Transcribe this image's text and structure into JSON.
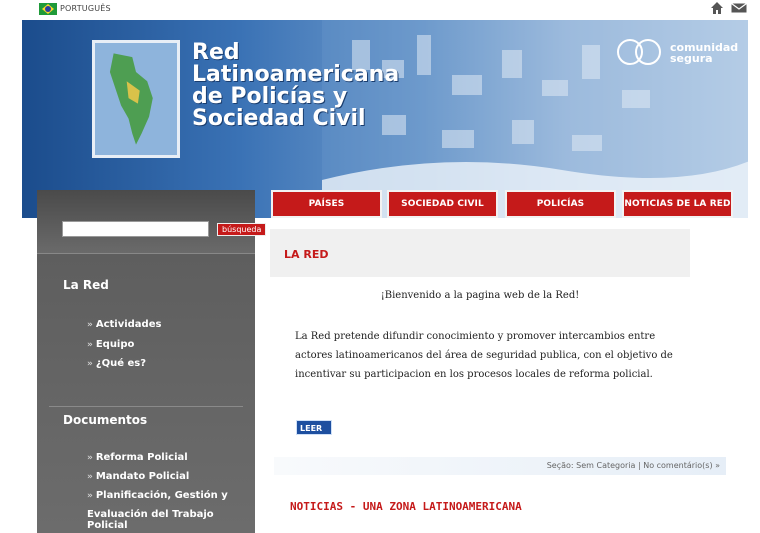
{
  "topbar": {
    "language": "PORTUGUÊS",
    "flag_icon": "brazil-flag-icon",
    "home_icon": "home-icon",
    "mail_icon": "mail-icon"
  },
  "banner": {
    "title_lines": [
      "Red",
      "Latinoamericana",
      "de Policías y",
      "Sociedad Civil"
    ],
    "partner_lines": [
      "comunidad",
      "segura"
    ]
  },
  "nav": {
    "items": [
      "PAÍSES",
      "SOCIEDAD CIVIL",
      "POLICÍAS",
      "NOTICIAS DE LA RED"
    ]
  },
  "sidebar": {
    "search": {
      "placeholder": "",
      "button_label": "búsqueda"
    },
    "sections": [
      {
        "heading": "La Red",
        "items": [
          "Actividades",
          "Equipo",
          "¿Qué es?"
        ]
      },
      {
        "heading": "Documentos",
        "items": [
          "Reforma Policial",
          "Mandato Policial",
          "Planificación, Gestión y",
          "Evaluación del Trabajo Policial"
        ]
      }
    ]
  },
  "main": {
    "section_title": "LA RED",
    "welcome": "¡Bienvenido a la pagina web de la Red!",
    "intro_lines": [
      "La Red pretende difundir conocimiento y promover intercambios entre",
      "actores latinoamericanos del área de seguridad publica, con el objetivo de",
      "incentivar su participacion en los procesos locales de reforma policial."
    ],
    "read_more": "LEER",
    "meta": "Seção: Sem Categoria | No comentário(s) »",
    "news_title": "NOTICIAS - UNA ZONA LATINOAMERICANA"
  },
  "colors": {
    "accent_red": "#c51a1a",
    "banner_blue": "#3a72b5",
    "sidebar_gray": "#5b5b5b"
  }
}
